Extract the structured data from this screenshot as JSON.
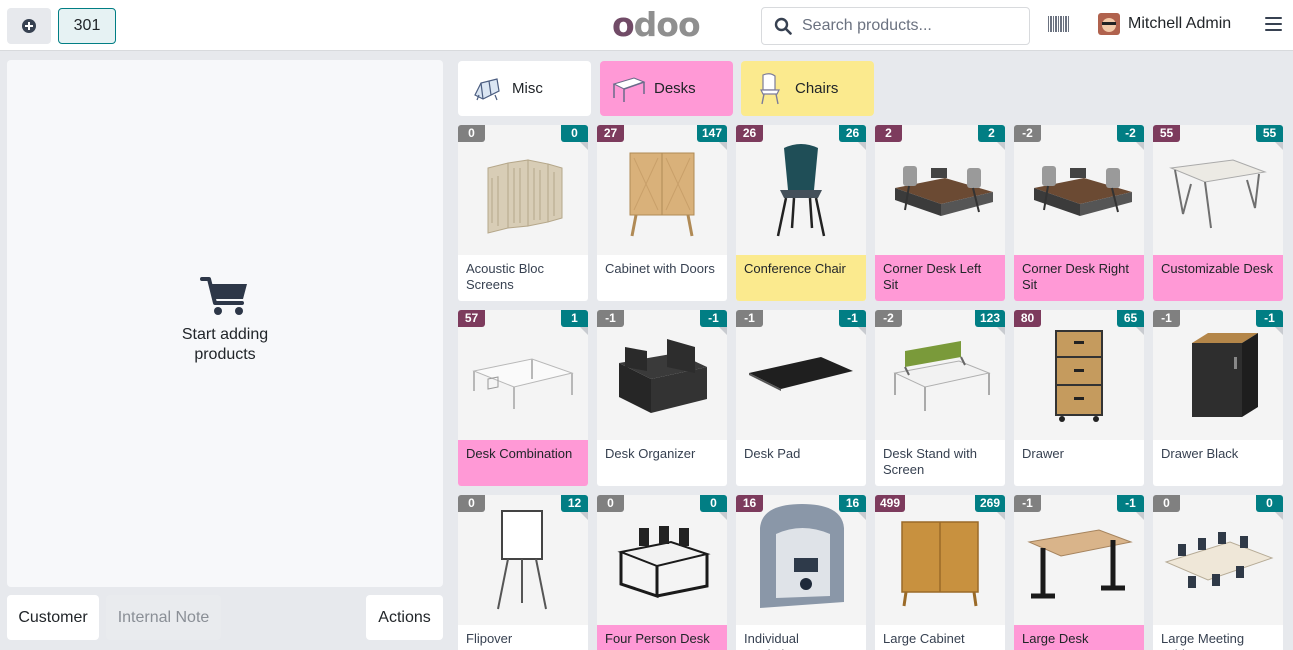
{
  "header": {
    "table_label": "301",
    "logo_first": "o",
    "logo_rest": "doo",
    "search_placeholder": "Search products...",
    "user_name": "Mitchell Admin"
  },
  "order": {
    "empty_text": "Start adding products",
    "customer_label": "Customer",
    "note_label": "Internal Note",
    "actions_label": "Actions"
  },
  "categories": [
    {
      "name": "Misc",
      "color": "#ffffff"
    },
    {
      "name": "Desks",
      "color": "#ff99d6"
    },
    {
      "name": "Chairs",
      "color": "#fbea8e"
    }
  ],
  "colors": {
    "accent": "#017e84",
    "brand": "#714b67",
    "pink": "#ff99d6",
    "yellow": "#fbea8e",
    "badge_purple": "#7d3b5d",
    "badge_gray": "#808080"
  },
  "products": [
    {
      "name": "Acoustic Bloc Screens",
      "left": "0",
      "right": "0",
      "left_style": "gray",
      "color": "white",
      "icon": "screen"
    },
    {
      "name": "Cabinet with Doors",
      "left": "27",
      "right": "147",
      "left_style": "purple",
      "color": "white",
      "icon": "cabinet"
    },
    {
      "name": "Conference Chair",
      "left": "26",
      "right": "26",
      "left_style": "purple",
      "color": "yellow",
      "icon": "chair"
    },
    {
      "name": "Corner Desk Left Sit",
      "left": "2",
      "right": "2",
      "left_style": "purple",
      "color": "pink",
      "icon": "desk-set"
    },
    {
      "name": "Corner Desk Right Sit",
      "left": "-2",
      "right": "-2",
      "left_style": "gray",
      "color": "pink",
      "icon": "desk-set"
    },
    {
      "name": "Customizable Desk",
      "left": "55",
      "right": "55",
      "left_style": "purple",
      "color": "pink",
      "icon": "table"
    },
    {
      "name": "Desk Combination",
      "left": "57",
      "right": "1",
      "left_style": "purple",
      "color": "pink",
      "icon": "desk-combo"
    },
    {
      "name": "Desk Organizer",
      "left": "-1",
      "right": "-1",
      "left_style": "gray",
      "color": "white",
      "icon": "organizer"
    },
    {
      "name": "Desk Pad",
      "left": "-1",
      "right": "-1",
      "left_style": "gray",
      "color": "white",
      "icon": "pad"
    },
    {
      "name": "Desk Stand with Screen",
      "left": "-2",
      "right": "123",
      "left_style": "gray",
      "color": "white",
      "icon": "stand"
    },
    {
      "name": "Drawer",
      "left": "80",
      "right": "65",
      "left_style": "purple",
      "color": "white",
      "icon": "drawer"
    },
    {
      "name": "Drawer Black",
      "left": "-1",
      "right": "-1",
      "left_style": "gray",
      "color": "white",
      "icon": "drawer-black"
    },
    {
      "name": "Flipover",
      "left": "0",
      "right": "12",
      "left_style": "gray",
      "color": "white",
      "icon": "flipover"
    },
    {
      "name": "Four Person Desk",
      "left": "0",
      "right": "0",
      "left_style": "gray",
      "color": "pink",
      "icon": "four-desk"
    },
    {
      "name": "Individual Workplace",
      "left": "16",
      "right": "16",
      "left_style": "purple",
      "color": "white",
      "icon": "pod"
    },
    {
      "name": "Large Cabinet",
      "left": "499",
      "right": "269",
      "left_style": "purple",
      "color": "white",
      "icon": "large-cabinet"
    },
    {
      "name": "Large Desk",
      "left": "-1",
      "right": "-1",
      "left_style": "gray",
      "color": "pink",
      "icon": "large-desk"
    },
    {
      "name": "Large Meeting Table",
      "left": "0",
      "right": "0",
      "left_style": "gray",
      "color": "white",
      "icon": "meeting-table"
    }
  ]
}
